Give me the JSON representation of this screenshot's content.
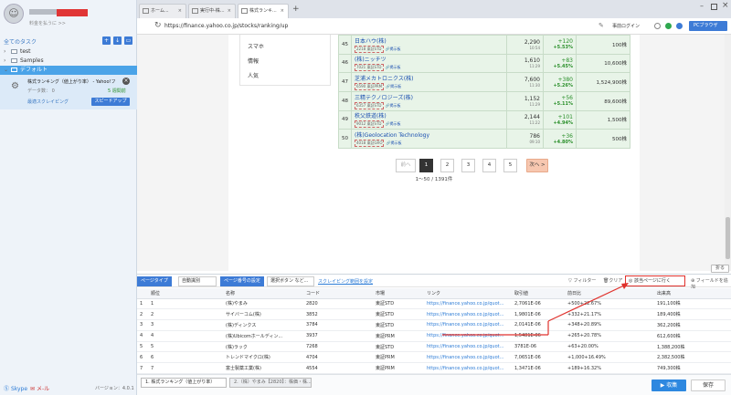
{
  "left_panel": {
    "user": {
      "avatar_label": "☺",
      "upgrade_text": "料金を払うに >>"
    },
    "tasks_title": "全てのタスク",
    "tree": [
      {
        "label": "test"
      },
      {
        "label": "Samples"
      },
      {
        "label": "デフォルト"
      }
    ],
    "task": {
      "name": "株式ランキング（値上がり率） - Yahoo!フ",
      "data_label": "データ数：",
      "data_count": "0",
      "time": "5 週間前",
      "mode": "最適スクレイピング",
      "speedup_label": "スピードアップ"
    },
    "footer": {
      "skype": "Skype",
      "mail": "メ-ル",
      "version": "バージョン：4.0.1"
    }
  },
  "browser": {
    "tabs": [
      {
        "label": "ホーム..."
      },
      {
        "label": "実行中-株..."
      },
      {
        "label": "株式ランキ..."
      }
    ],
    "url": "https://finance.yahoo.co.jp/stocks/ranking/up",
    "login_label": "事前ログイン",
    "pc_browser_label": "PCブラウザ",
    "nav_links": [
      "スマホ",
      "情報",
      "人気"
    ],
    "ranking_rows": [
      {
        "no": "45",
        "name": "日本ハウ(株)",
        "code": "2218 東証STD",
        "board": "掲示板",
        "price": "2,290",
        "time": "10:54",
        "change": "+120",
        "rate": "+5.53%",
        "volume": "100株"
      },
      {
        "no": "46",
        "name": "(株)ニッチツ",
        "code": "7021 東証STD",
        "board": "掲示板",
        "price": "1,610",
        "time": "11:29",
        "change": "+83",
        "rate": "+5.45%",
        "volume": "10,600株"
      },
      {
        "no": "47",
        "name": "芝浦メカトロニクス(株)",
        "code": "6590 東証PRM",
        "board": "掲示板",
        "price": "7,600",
        "time": "11:30",
        "change": "+380",
        "rate": "+5.26%",
        "volume": "1,524,900株"
      },
      {
        "no": "48",
        "name": "三精テクノロジーズ(株)",
        "code": "6357 東証STD",
        "board": "掲示板",
        "price": "1,152",
        "time": "11:29",
        "change": "+56",
        "rate": "+5.11%",
        "volume": "89,600株"
      },
      {
        "no": "49",
        "name": "秩父鉄道(株)",
        "code": "9012 東証STD",
        "board": "掲示板",
        "price": "2,144",
        "time": "11:22",
        "change": "+101",
        "rate": "+4.94%",
        "volume": "1,500株"
      },
      {
        "no": "50",
        "name": "(株)Geolocation Technology",
        "code": "4018 東証GRO",
        "board": "掲示板",
        "price": "786",
        "time": "09:10",
        "change": "+36",
        "rate": "+4.80%",
        "volume": "500株"
      }
    ],
    "pager": {
      "prev": "前へ",
      "pages": [
        "1",
        "2",
        "3",
        "4",
        "5"
      ],
      "next": "次へ >",
      "count": "1〜50 / 1391件"
    }
  },
  "fold_label": "折る",
  "toolbar": {
    "page_type_label": "ページタイプ",
    "page_type_value": "自動識別",
    "page_setting_label": "ページ番号の設定",
    "page_setting_value": "選択ボタン など...",
    "scrape_range_label": "スクレイピング範囲を設定",
    "filter_label": "フィルター",
    "clear_label": "クリア",
    "check_page_label": "該当ページに行く",
    "add_field_label": "フィールドを追加"
  },
  "grid": {
    "columns": [
      "",
      "順位",
      "名称",
      "コード",
      "市場",
      "リンク",
      "取引値",
      "前日比",
      "出来高"
    ],
    "rows": [
      [
        "1",
        "1",
        "(株)やまみ",
        "2820",
        "東証STD",
        "https://finance.yahoo.co.jp/quot...",
        "2,7061E-06",
        "+500+22.67%",
        "191,100株"
      ],
      [
        "2",
        "2",
        "サイバーコム(株)",
        "3852",
        "東証STD",
        "https://finance.yahoo.co.jp/quot...",
        "1,9801E-06",
        "+332+21.17%",
        "189,400株"
      ],
      [
        "3",
        "3",
        "(株)ディンクス",
        "3784",
        "東証STD",
        "https://finance.yahoo.co.jp/quot...",
        "2,0141E-06",
        "+348+20.89%",
        "362,200株"
      ],
      [
        "4",
        "4",
        "(株)Ubicomホールディン...",
        "3937",
        "東証PRM",
        "https://finance.yahoo.co.jp/quot...",
        "1,5481E-06",
        "+265+20.78%",
        "612,600株"
      ],
      [
        "5",
        "5",
        "(株)ラック",
        "7268",
        "東証STD",
        "https://finance.yahoo.co.jp/quot...",
        "3781E-06",
        "+63+20.00%",
        "1,388,200株"
      ],
      [
        "6",
        "6",
        "トレンドマイクロ(株)",
        "4704",
        "東証PRM",
        "https://finance.yahoo.co.jp/quot...",
        "7,0651E-06",
        "+1,000+16.49%",
        "2,382,500株"
      ],
      [
        "7",
        "7",
        "富士製薬工業(株)",
        "4554",
        "東証PRM",
        "https://finance.yahoo.co.jp/quot...",
        "1,3471E-06",
        "+189+16.32%",
        "749,300株"
      ]
    ]
  },
  "bottom": {
    "tabs": [
      {
        "label": "1. 株式ランキング（値上がり率）"
      },
      {
        "label": "2.（株）やまみ【2820】：株価・株..."
      }
    ],
    "collect_label": "▶ 収集",
    "save_label": "保存"
  },
  "colors": {
    "accent": "#3d7bd6",
    "selected_task": "#4aa3e8",
    "highlight": "#e0322d",
    "up": "#2a8f2a"
  }
}
